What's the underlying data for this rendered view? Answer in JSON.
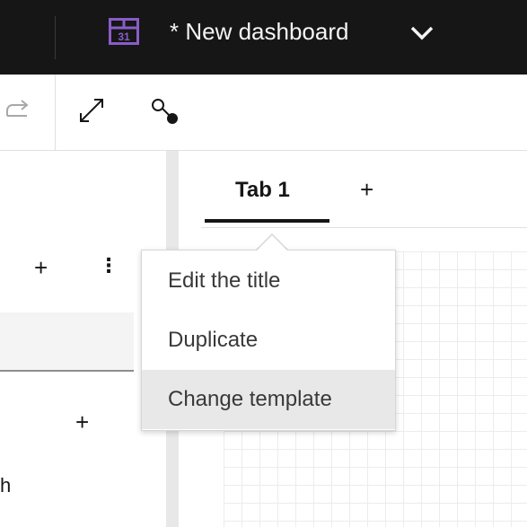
{
  "header": {
    "title": "* New dashboard",
    "icons": [
      "dashboard-icon",
      "chevron-down-icon"
    ]
  },
  "toolbar": {
    "icons": [
      "redo-icon",
      "fullscreen-icon",
      "connect-icon"
    ]
  },
  "tabs": [
    {
      "label": "Tab 1",
      "selected": true
    }
  ],
  "tab_add_label": "+",
  "left_panel": {
    "add_label": "+",
    "more_label": "⋮",
    "second_add_label": "+",
    "partial_text": "h"
  },
  "context_menu": {
    "items": [
      {
        "label": "Edit the title"
      },
      {
        "label": "Duplicate"
      },
      {
        "label": "Change template",
        "hovered": true
      }
    ]
  },
  "colors": {
    "header_bg": "#161616",
    "menu_hover": "#e8e8e8",
    "accent_icon": "#8a5cc7"
  }
}
